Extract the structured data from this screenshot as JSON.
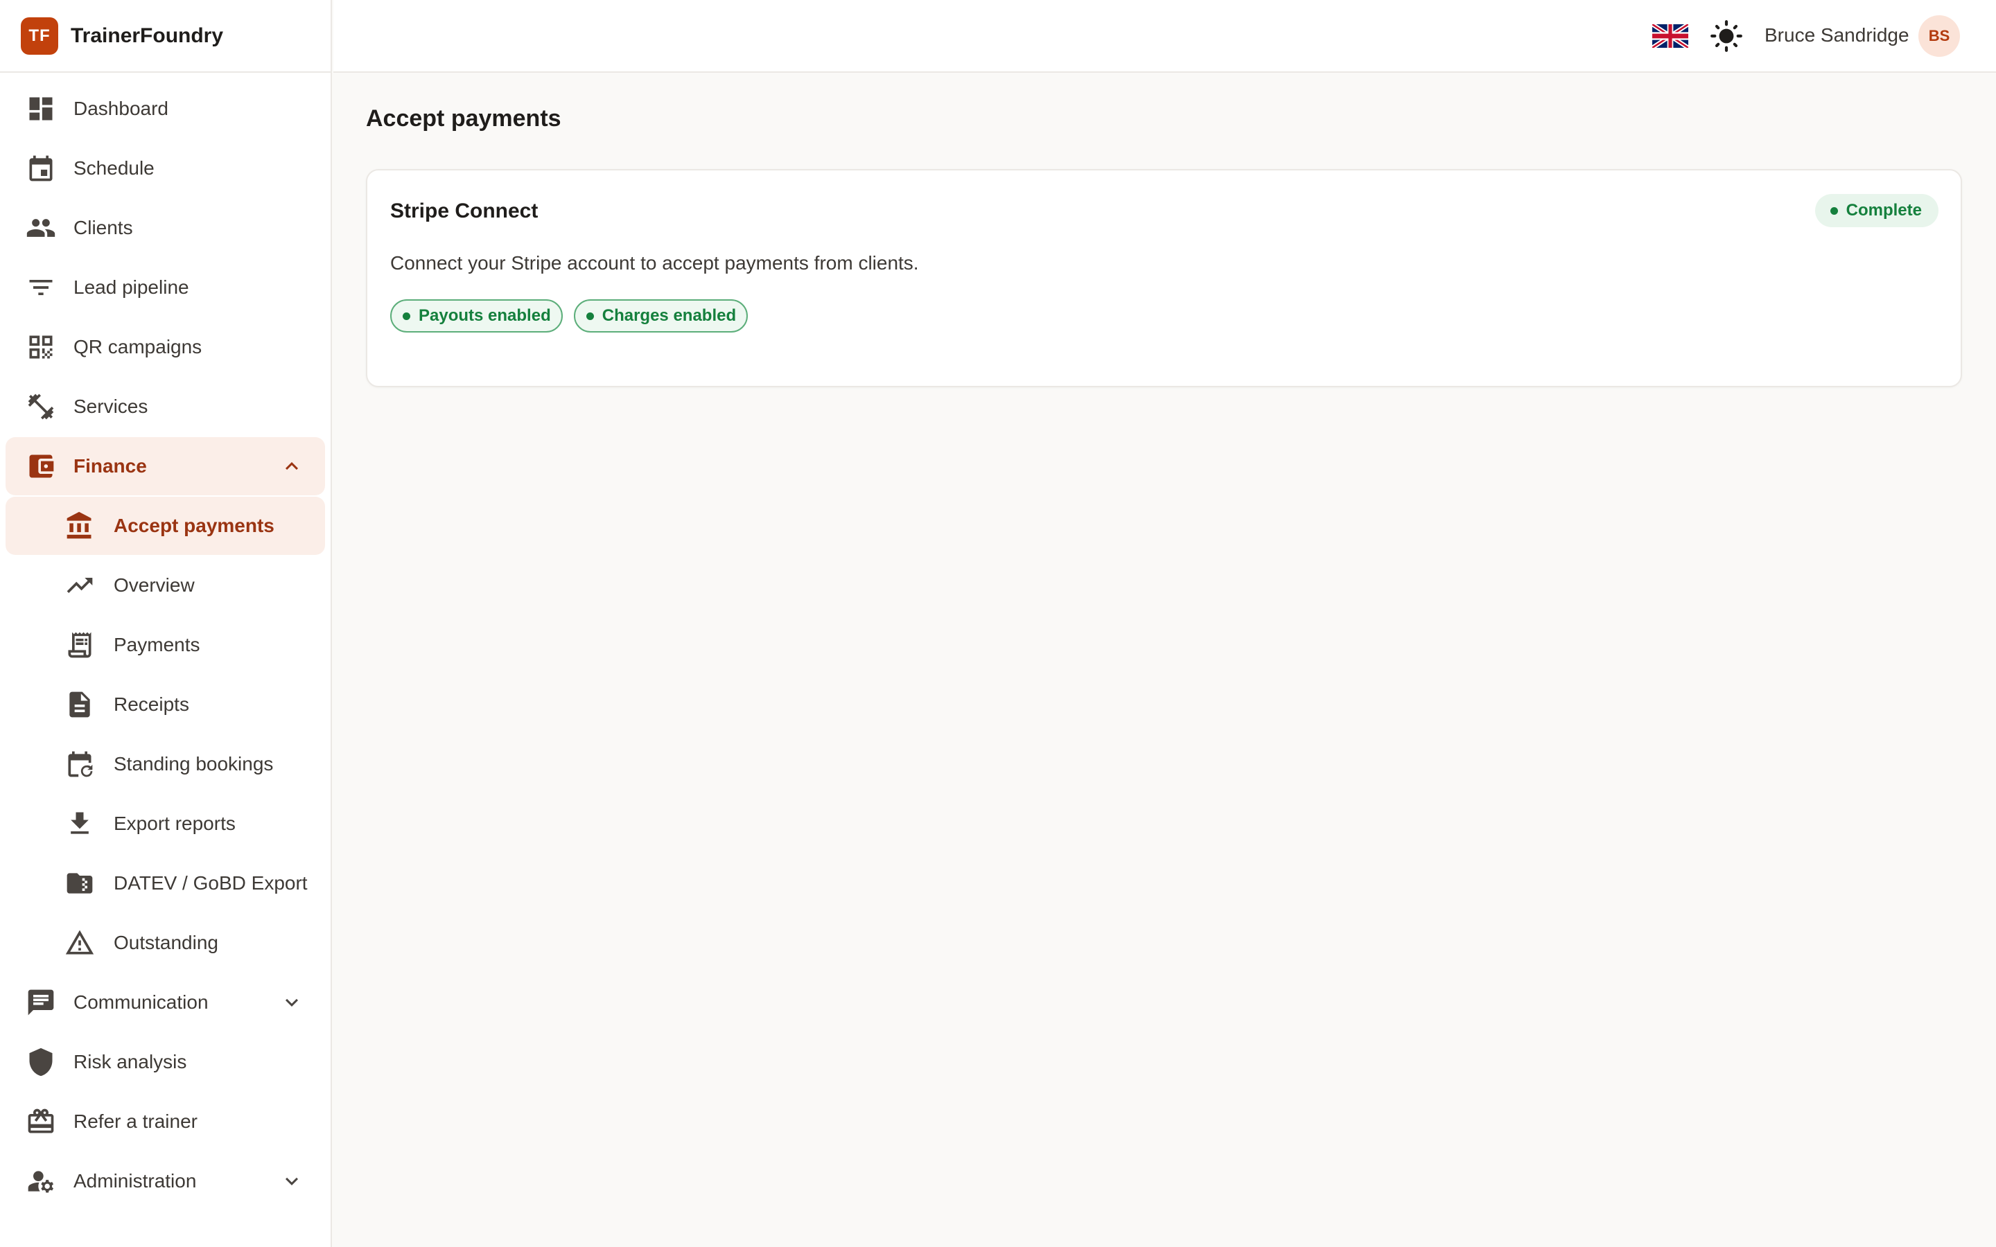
{
  "brand": {
    "logo_text": "TF",
    "name": "TrainerFoundry"
  },
  "header": {
    "language_icon": "uk-flag-icon",
    "theme_icon": "sun-icon",
    "user_name": "Bruce Sandridge",
    "user_initials": "BS"
  },
  "sidebar": {
    "items": [
      {
        "label": "Dashboard",
        "icon": "dashboard-icon"
      },
      {
        "label": "Schedule",
        "icon": "calendar-icon"
      },
      {
        "label": "Clients",
        "icon": "people-icon"
      },
      {
        "label": "Lead pipeline",
        "icon": "filter-icon"
      },
      {
        "label": "QR campaigns",
        "icon": "qr-code-icon"
      },
      {
        "label": "Services",
        "icon": "fitness-icon"
      },
      {
        "label": "Finance",
        "icon": "wallet-icon",
        "expanded": true
      },
      {
        "label": "Communication",
        "icon": "chat-icon",
        "expanded": false
      },
      {
        "label": "Risk analysis",
        "icon": "shield-icon"
      },
      {
        "label": "Refer a trainer",
        "icon": "gift-icon"
      },
      {
        "label": "Administration",
        "icon": "manage-accounts-icon",
        "expanded": false
      }
    ],
    "finance_sub": [
      {
        "label": "Accept payments",
        "icon": "bank-icon",
        "active": true
      },
      {
        "label": "Overview",
        "icon": "trending-up-icon"
      },
      {
        "label": "Payments",
        "icon": "receipt-long-icon"
      },
      {
        "label": "Receipts",
        "icon": "document-icon"
      },
      {
        "label": "Standing bookings",
        "icon": "recurring-calendar-icon"
      },
      {
        "label": "Export reports",
        "icon": "download-icon"
      },
      {
        "label": "DATEV / GoBD Export",
        "icon": "archive-folder-icon"
      },
      {
        "label": "Outstanding",
        "icon": "warning-icon"
      }
    ]
  },
  "main": {
    "title": "Accept payments",
    "card": {
      "title": "Stripe Connect",
      "status": "Complete",
      "description": "Connect your Stripe account to accept payments from clients.",
      "badges": [
        "Payouts enabled",
        "Charges enabled"
      ]
    }
  },
  "colors": {
    "accent": "#c2410c",
    "accent_text": "#9a3412",
    "active_bg": "#fbeee8",
    "success": "#15803d",
    "success_bg": "#e8f5ec"
  }
}
